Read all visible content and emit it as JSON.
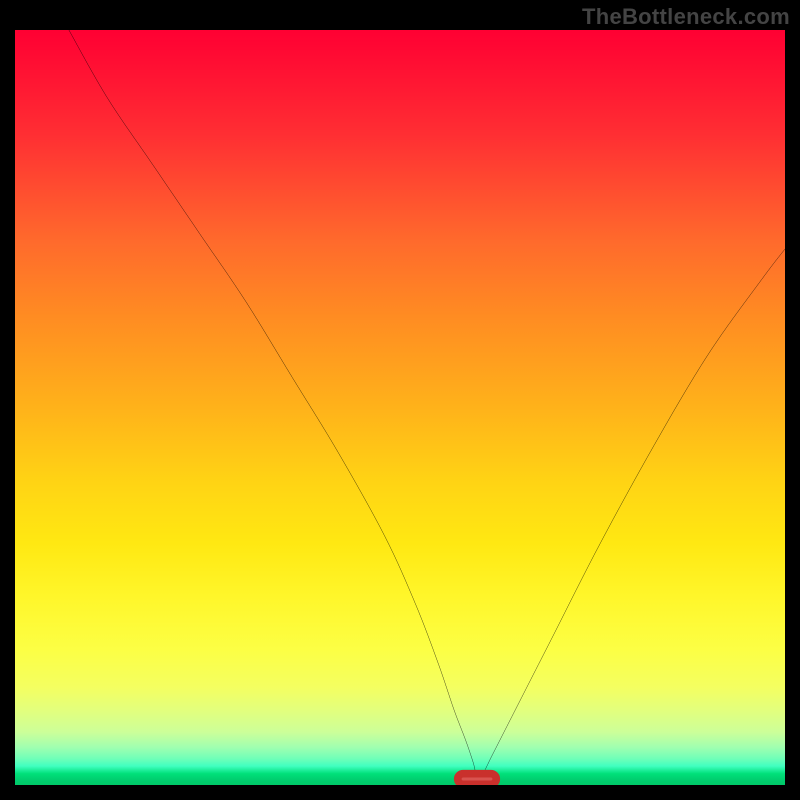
{
  "watermark": "TheBottleneck.com",
  "chart_data": {
    "type": "line",
    "title": "",
    "xlabel": "",
    "ylabel": "",
    "xlim": [
      0,
      100
    ],
    "ylim": [
      0,
      100
    ],
    "series": [
      {
        "name": "bottleneck-curve",
        "x": [
          7,
          12,
          18,
          24,
          30,
          36,
          42,
          48,
          52,
          55,
          57,
          58.5,
          59.5,
          60,
          60.8,
          62,
          65,
          70,
          76,
          83,
          90,
          97,
          100
        ],
        "y": [
          100,
          91,
          82,
          73,
          64,
          54,
          44,
          33,
          24,
          16,
          10,
          6,
          3,
          1.2,
          1.6,
          4,
          10,
          20,
          32,
          45,
          57,
          67,
          71
        ]
      }
    ],
    "marker": {
      "name": "optimal-point",
      "x": 60,
      "y": 0.8,
      "width": 5,
      "height": 1.4,
      "color": "#d9534f"
    },
    "background_gradient": {
      "top": "#ff0033",
      "bottom": "#00c868"
    }
  }
}
